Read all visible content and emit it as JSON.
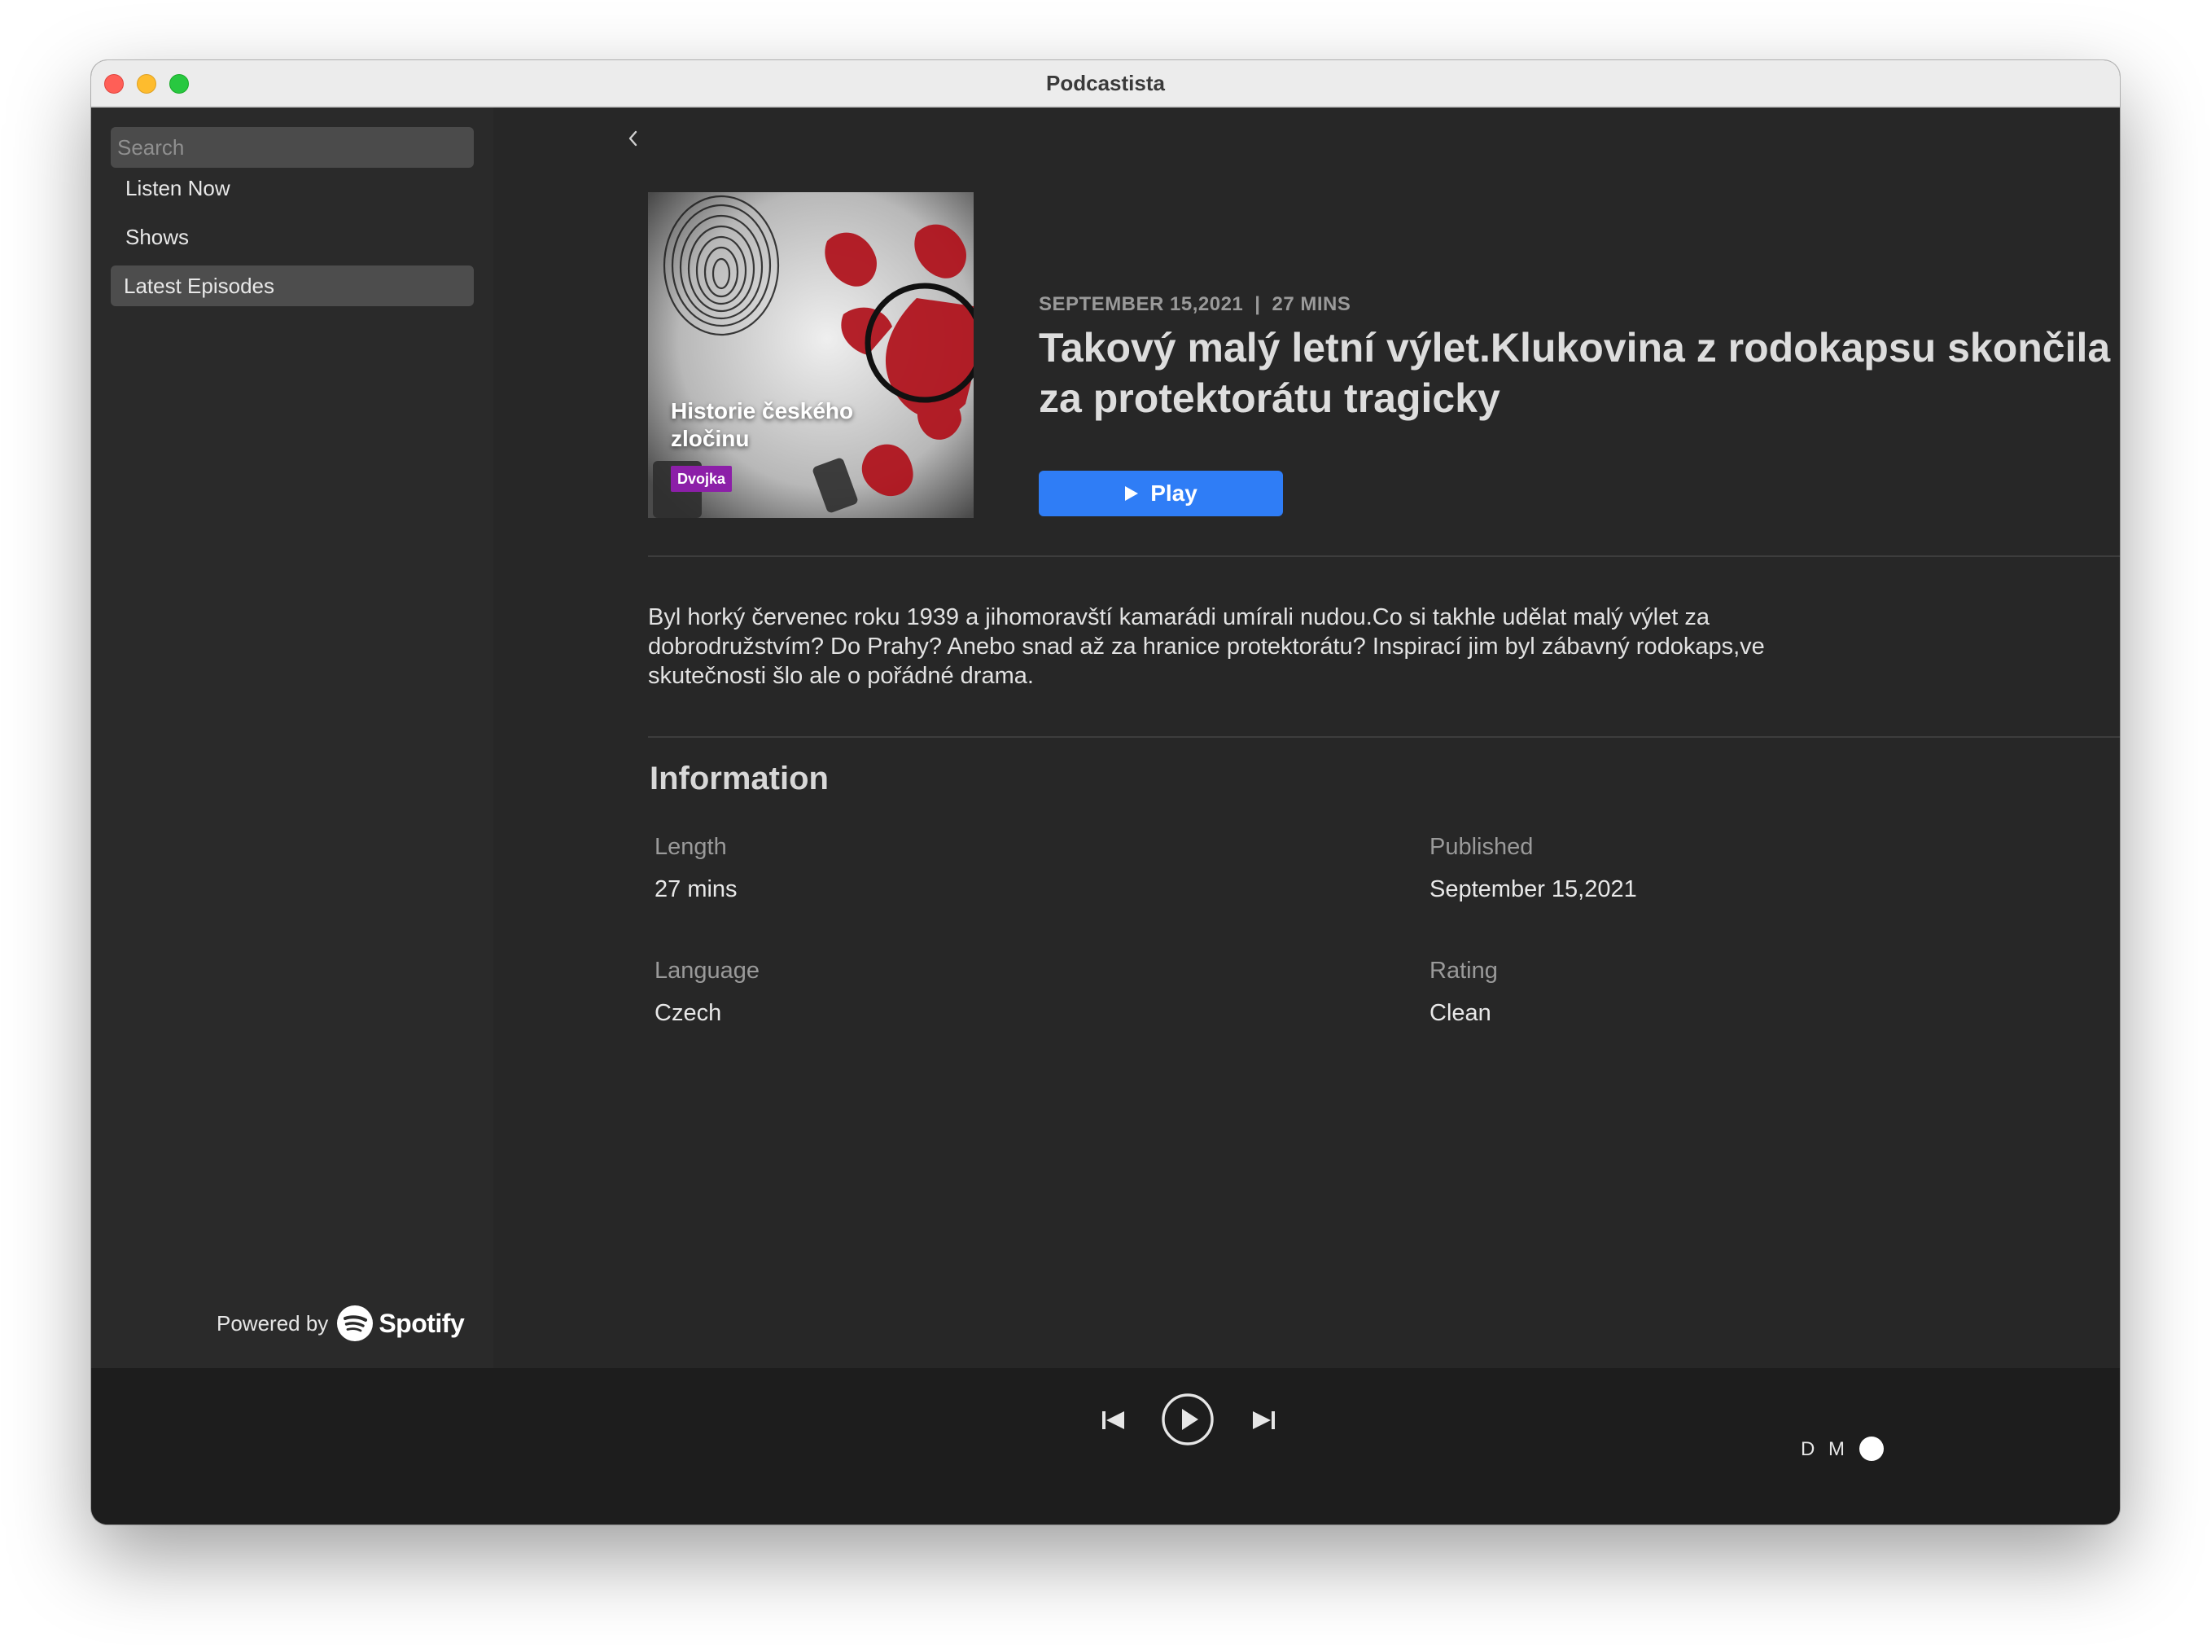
{
  "window": {
    "title": "Podcastista"
  },
  "sidebar": {
    "search_placeholder": "Search",
    "items": [
      {
        "label": "Listen Now"
      },
      {
        "label": "Shows"
      },
      {
        "label": "Latest Episodes",
        "selected": true
      }
    ],
    "powered_by": "Powered by",
    "brand": "Spotify"
  },
  "episode": {
    "date": "SEPTEMBER 15,2021",
    "separator": "|",
    "duration": "27 MINS",
    "title": "Takový malý letní výlet.Klukovina z rodokapsu skončila za protektorátu tragicky",
    "play_label": "Play",
    "artwork": {
      "show_title": "Historie českého zločinu",
      "badge": "Dvojka"
    },
    "description": "Byl horký červenec roku 1939 a jihomoravští kamarádi umírali nudou.Co si takhle udělat malý výlet za dobrodružstvím? Do Prahy? Anebo snad až za hranice protektorátu? Inspirací jim byl zábavný rodokaps,ve skutečnosti šlo ale o pořádné drama."
  },
  "information": {
    "heading": "Information",
    "length_label": "Length",
    "length_value": "27 mins",
    "published_label": "Published",
    "published_value": "September 15,2021",
    "language_label": "Language",
    "language_value": "Czech",
    "rating_label": "Rating",
    "rating_value": "Clean"
  },
  "player": {
    "controls": [
      "previous-icon",
      "play-circle-icon",
      "next-icon"
    ],
    "toggle_left": "D",
    "toggle_right": "M"
  },
  "colors": {
    "accent": "#2f7df6",
    "sidebar_bg": "#2a2a2a",
    "content_bg": "#272727",
    "player_bg": "#1d1d1d"
  }
}
